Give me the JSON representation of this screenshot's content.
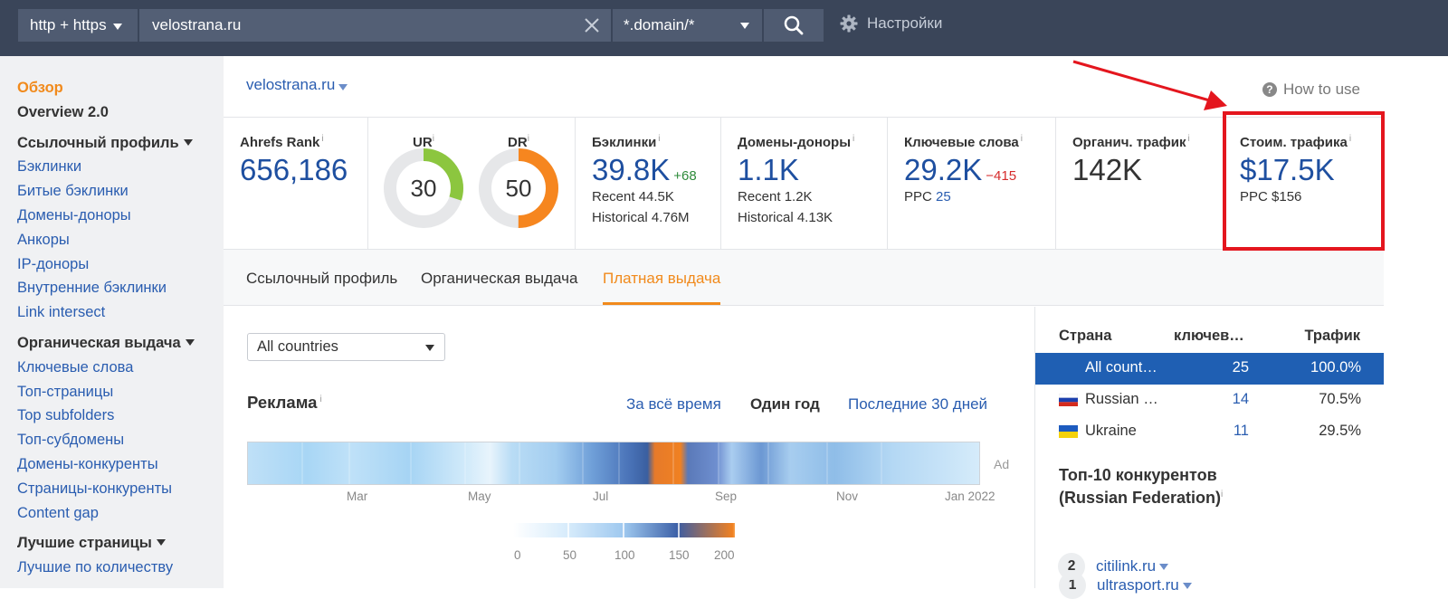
{
  "topbar": {
    "protocol": "http + https",
    "url_value": "velostrana.ru",
    "mode": "*.domain/*",
    "settings_label": "Настройки",
    "bg_color": "#3a4559"
  },
  "sidebar": {
    "overview": "Обзор",
    "overview2": "Overview 2.0",
    "sections": [
      {
        "title": "Ссылочный профиль",
        "items": [
          "Бэклинки",
          "Битые бэклинки",
          "Домены-доноры",
          "Анкоры",
          "IP-доноры",
          "Внутренние бэклинки",
          "Link intersect"
        ]
      },
      {
        "title": "Органическая выдача",
        "items": [
          "Ключевые слова",
          "Топ-страницы",
          "Top subfolders",
          "Топ-субдомены",
          "Домены-конкуренты",
          "Страницы-конкуренты",
          "Content gap"
        ]
      },
      {
        "title": "Лучшие страницы",
        "items": [
          "Лучшие по количеству"
        ]
      }
    ]
  },
  "header": {
    "domain": "velostrana.ru",
    "how_to_use": "How to use"
  },
  "metrics": {
    "ahrefs_rank": {
      "label": "Ahrefs Rank",
      "value": "656,186"
    },
    "ur": {
      "label": "UR",
      "value": "30",
      "score": 30
    },
    "dr": {
      "label": "DR",
      "value": "50",
      "score": 50
    },
    "backlinks": {
      "label": "Бэклинки",
      "value": "39.8K",
      "delta": "+68",
      "recent": "Recent 44.5K",
      "historical": "Historical 4.76M"
    },
    "ref_domains": {
      "label": "Домены-доноры",
      "value": "1.1K",
      "recent": "Recent 1.2K",
      "historical": "Historical 4.13K"
    },
    "keywords": {
      "label": "Ключевые слова",
      "value": "29.2K",
      "delta": "−415",
      "ppc_label": "PPC",
      "ppc_value": "25"
    },
    "organic_traffic": {
      "label": "Органич. трафик",
      "value": "142K"
    },
    "traffic_cost": {
      "label": "Стоим. трафика",
      "value": "$17.5K",
      "ppc": "PPC $156"
    }
  },
  "tabs": [
    "Ссылочный профиль",
    "Органическая выдача",
    "Платная выдача"
  ],
  "active_tab": "Платная выдача",
  "filter": {
    "country_select": "All countries"
  },
  "ads": {
    "title": "Реклама",
    "periods": [
      "За всё время",
      "Один год",
      "Последние 30 дней"
    ],
    "active_period": "Один год",
    "ad_tag": "Ad",
    "months": [
      "Mar",
      "May",
      "Jul",
      "Sep",
      "Nov",
      "Jan 2022"
    ],
    "legend_ticks": [
      "0",
      "50",
      "100",
      "150",
      "200"
    ]
  },
  "countries": {
    "headers": [
      "Страна",
      "ключев…",
      "Трафик"
    ],
    "rows": [
      {
        "country": "All count…",
        "keywords": "25",
        "traffic": "100.0%",
        "selected": true
      },
      {
        "country": "Russian …",
        "keywords": "14",
        "traffic": "70.5%"
      },
      {
        "country": "Ukraine",
        "keywords": "11",
        "traffic": "29.5%"
      }
    ]
  },
  "competitors": {
    "title_line1": "Топ-10 конкурентов",
    "title_line2": "(Russian Federation)",
    "items": [
      {
        "rank": "1",
        "domain": "ultrasport.ru"
      },
      {
        "rank": "2",
        "domain": "citilink.ru"
      }
    ]
  },
  "colors": {
    "accent": "#f18a1c",
    "link": "#2a5db0",
    "highlight": "#e4161e",
    "ur_ring": "#8cc63f",
    "dr_ring": "#f6861f"
  }
}
